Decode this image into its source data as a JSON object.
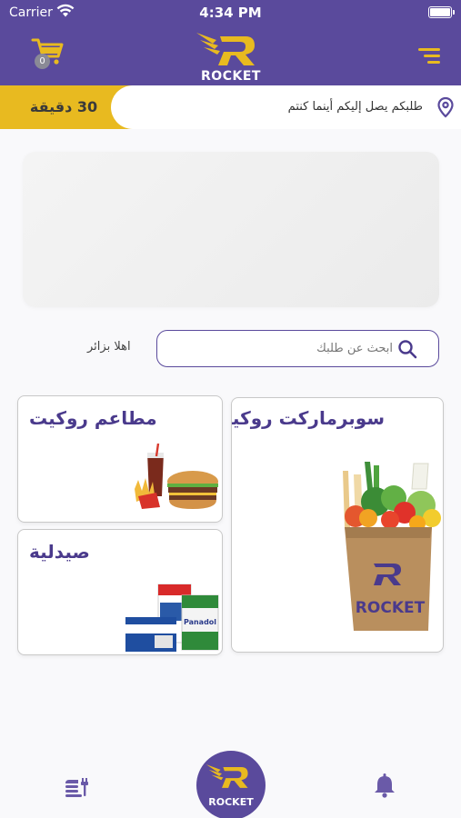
{
  "status_bar": {
    "carrier": "Carrier",
    "time": "4:34 PM"
  },
  "header": {
    "logo_text": "ROCKET",
    "cart_count": "0"
  },
  "delivery": {
    "time_label": "30 دقيقة",
    "message": "طلبكم يصل إليكم أينما كنتم"
  },
  "search": {
    "placeholder": "ابحث عن طلبك",
    "greeting": "اهلا بزائر"
  },
  "categories": [
    {
      "title": "سوبرماركت روكيت",
      "bag_text": "ROCKET"
    },
    {
      "title": "مطاعم روكيت"
    },
    {
      "title": "صيدلية",
      "pack_text": "Panadol"
    }
  ],
  "bottom_nav": {
    "home_text": "ROCKET"
  },
  "colors": {
    "brand": "#5a4a9c",
    "accent": "#e8ba20"
  },
  "icons": [
    "wifi-icon",
    "battery-icon",
    "cart-icon",
    "menu-icon",
    "location-pin-icon",
    "search-icon",
    "food-menu-icon",
    "bell-icon",
    "rocket-logo-icon"
  ]
}
